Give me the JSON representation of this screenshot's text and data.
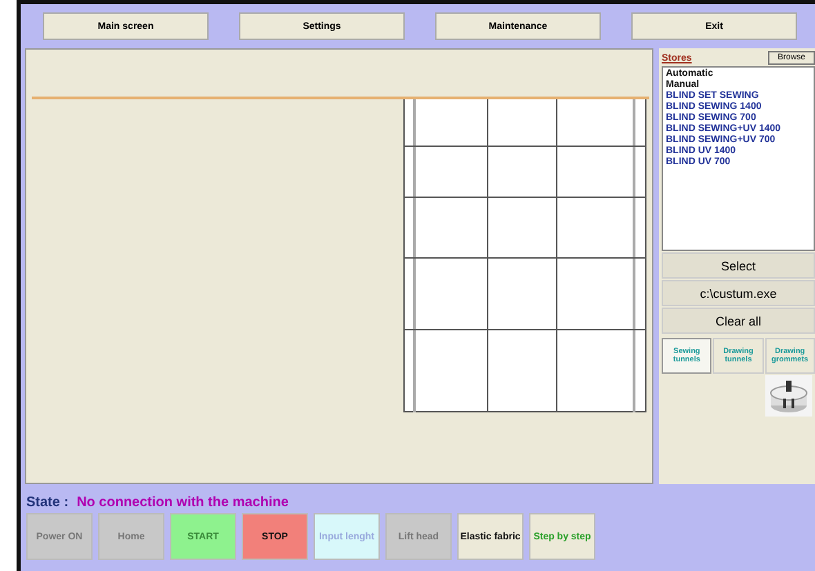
{
  "menu": [
    {
      "label": "Main screen"
    },
    {
      "label": "Settings"
    },
    {
      "label": "Maintenance"
    },
    {
      "label": "Exit"
    }
  ],
  "stores": {
    "title": "Stores",
    "browse": "Browse",
    "items": [
      "Automatic",
      "Manual",
      "BLIND SET SEWING",
      "BLIND SEWING 1400",
      "BLIND SEWING 700",
      "BLIND SEWING+UV 1400",
      "BLIND SEWING+UV 700",
      "BLIND UV 1400",
      "BLIND UV 700"
    ]
  },
  "actions": [
    "Select",
    "c:\\custum.exe",
    "Clear all"
  ],
  "tabs": [
    {
      "label": "Sewing tunnels",
      "selected": true
    },
    {
      "label": "Drawing tunnels",
      "selected": false
    },
    {
      "label": "Drawing grommets",
      "selected": false
    }
  ],
  "state": {
    "label": "State :",
    "value": "No connection with the machine"
  },
  "buttons": [
    {
      "label": "Power ON",
      "kind": "grey",
      "disabled": true
    },
    {
      "label": "Home",
      "kind": "grey",
      "disabled": true
    },
    {
      "label": "START",
      "kind": "green",
      "disabled": true
    },
    {
      "label": "STOP",
      "kind": "red",
      "disabled": false
    },
    {
      "label": "Input lenght",
      "kind": "cyan",
      "disabled": true
    },
    {
      "label": "Lift head",
      "kind": "grey",
      "disabled": true
    },
    {
      "label": "Elastic fabric",
      "kind": "beige",
      "disabled": false
    },
    {
      "label": "Step by step",
      "kind": "beige-green",
      "disabled": false
    }
  ]
}
